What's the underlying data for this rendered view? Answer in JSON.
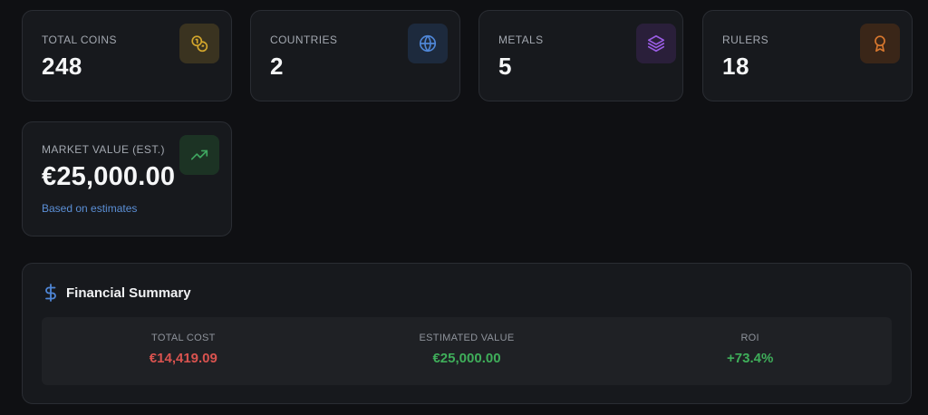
{
  "stats": {
    "total_coins": {
      "label": "TOTAL COINS",
      "value": "248",
      "icon": "coins-icon",
      "accent": "#d4a72c"
    },
    "countries": {
      "label": "COUNTRIES",
      "value": "2",
      "icon": "globe-icon",
      "accent": "#4f86d6"
    },
    "metals": {
      "label": "METALS",
      "value": "5",
      "icon": "layers-icon",
      "accent": "#9b5de5"
    },
    "rulers": {
      "label": "RULERS",
      "value": "18",
      "icon": "award-icon",
      "accent": "#d9782e"
    }
  },
  "market_value": {
    "label": "MARKET VALUE (EST.)",
    "value": "€25,000.00",
    "note": "Based on estimates",
    "icon": "trending-up-icon",
    "accent": "#3fa760"
  },
  "financial_summary": {
    "title": "Financial Summary",
    "icon": "dollar-icon",
    "columns": [
      {
        "label": "TOTAL COST",
        "value": "€14,419.09",
        "color": "#d9534f"
      },
      {
        "label": "ESTIMATED VALUE",
        "value": "€25,000.00",
        "color": "#3fae5a"
      },
      {
        "label": "ROI",
        "value": "+73.4%",
        "color": "#3fae5a"
      }
    ]
  }
}
